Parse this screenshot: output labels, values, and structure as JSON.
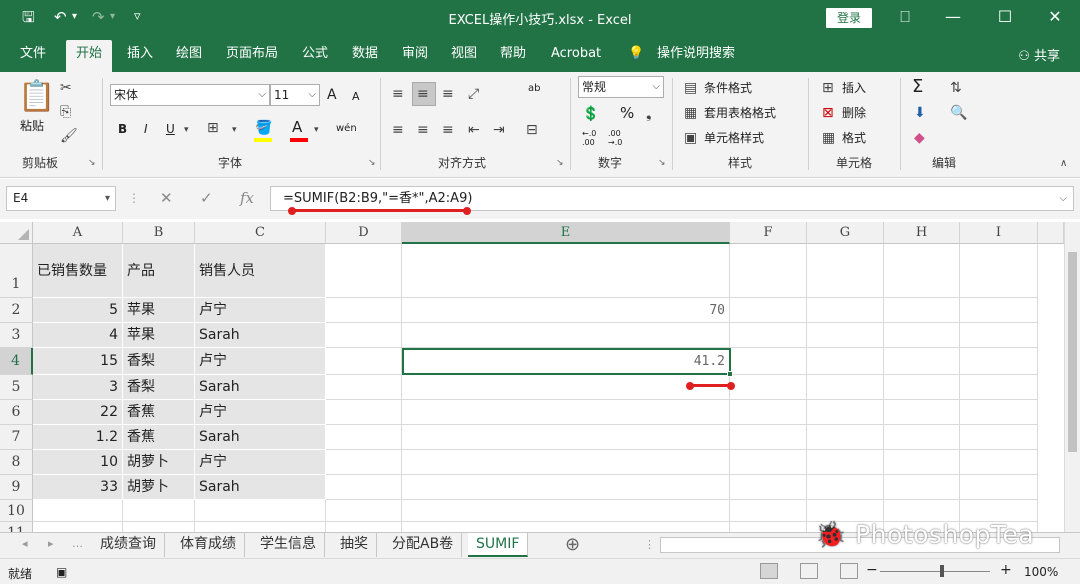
{
  "window": {
    "title": "EXCEL操作小技巧.xlsx  -  Excel",
    "login": "登录",
    "qa_save": "🖫",
    "qa_undo": "↶",
    "qa_undo_menu": "▾",
    "qa_redo": "↷",
    "qa_redo_menu": "▾",
    "qa_customize": "▿",
    "ribbon_toggle": "⎕",
    "minimize": "—",
    "maximize": "☐",
    "close": "✕"
  },
  "tabs": [
    "文件",
    "开始",
    "插入",
    "绘图",
    "页面布局",
    "公式",
    "数据",
    "审阅",
    "视图",
    "帮助",
    "Acrobat",
    "操作说明搜索"
  ],
  "active_tab": "开始",
  "share": "共享",
  "ribbon": {
    "clipboard": {
      "paste": "粘贴",
      "label": "剪贴板"
    },
    "font": {
      "name": "宋体",
      "size": "11",
      "bold": "B",
      "italic": "I",
      "underline": "U",
      "grow": "A",
      "shrink": "A",
      "font_color": "A",
      "phonetic": "wén",
      "label": "字体"
    },
    "alignment": {
      "label": "对齐方式",
      "wrap": "ab"
    },
    "number": {
      "format": "常规",
      "percent": "%",
      "label": "数字"
    },
    "styles": {
      "conditional": "条件格式",
      "table": "套用表格格式",
      "cell": "单元格样式",
      "label": "样式"
    },
    "cells": {
      "insert": "插入",
      "delete": "删除",
      "format": "格式",
      "label": "单元格"
    },
    "editing": {
      "sum": "Σ",
      "label": "编辑"
    }
  },
  "formula_bar": {
    "name_box": "E4",
    "cancel": "✕",
    "enter": "✓",
    "fx": "fx",
    "formula": "=SUMIF(B2:B9,\"=香*\",A2:A9)"
  },
  "grid": {
    "columns": [
      "A",
      "B",
      "C",
      "D",
      "E",
      "F",
      "G",
      "H",
      "I"
    ],
    "selected_column": "E",
    "selected_row": "4",
    "rows": [
      "1",
      "2",
      "3",
      "4",
      "5",
      "6",
      "7",
      "8",
      "9",
      "10",
      "11"
    ],
    "header_row": [
      "已销售数量",
      "产品",
      "销售人员"
    ],
    "data": [
      [
        "5",
        "苹果",
        "卢宁"
      ],
      [
        "4",
        "苹果",
        "Sarah"
      ],
      [
        "15",
        "香梨",
        "卢宁"
      ],
      [
        "3",
        "香梨",
        "Sarah"
      ],
      [
        "22",
        "香蕉",
        "卢宁"
      ],
      [
        "1.2",
        "香蕉",
        "Sarah"
      ],
      [
        "10",
        "胡萝卜",
        "卢宁"
      ],
      [
        "33",
        "胡萝卜",
        "Sarah"
      ]
    ],
    "e2": "70",
    "e4": "41.2"
  },
  "sheets": [
    "成绩查询",
    "体育成绩",
    "学生信息",
    "抽奖",
    "分配AB卷",
    "SUMIF"
  ],
  "active_sheet": "SUMIF",
  "add_sheet": "⊕",
  "watermark": "PhotoshopTea",
  "status": {
    "ready": "就绪",
    "zoom": "100%",
    "zoom_out": "−",
    "zoom_in": "+"
  },
  "colors": {
    "accent": "#217346",
    "annotation": "#e02020"
  }
}
